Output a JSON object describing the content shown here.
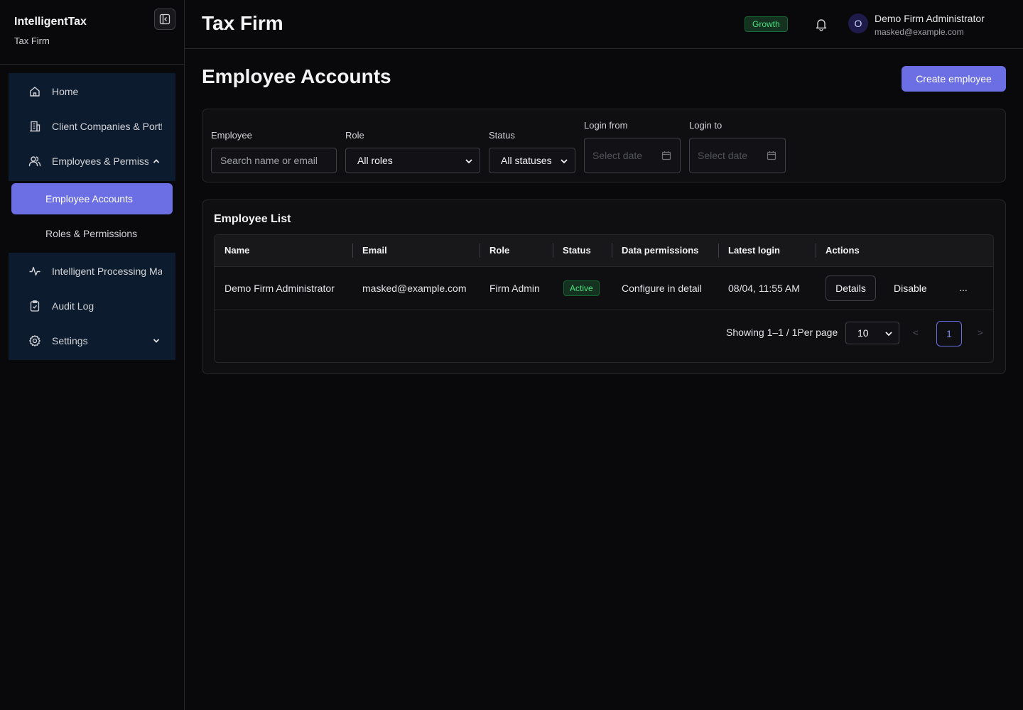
{
  "sidebar": {
    "brand": "IntelligentTax",
    "subtitle": "Tax Firm",
    "items": [
      {
        "label": "Home"
      },
      {
        "label": "Client Companies & Portfolios"
      },
      {
        "label": "Employees & Permissions"
      },
      {
        "label": "Intelligent Processing Management"
      },
      {
        "label": "Audit Log"
      },
      {
        "label": "Settings"
      }
    ],
    "sub_items": [
      {
        "label": "Employee Accounts",
        "active": true
      },
      {
        "label": "Roles & Permissions",
        "active": false
      }
    ]
  },
  "header": {
    "title": "Tax Firm",
    "plan": "Growth",
    "avatar_initial": "O",
    "user_name": "Demo Firm Administrator",
    "user_email": "masked@example.com"
  },
  "page": {
    "title": "Employee Accounts",
    "create_button": "Create employee"
  },
  "filters": {
    "employee_label": "Employee",
    "employee_placeholder": "Search name or email",
    "role_label": "Role",
    "role_value": "All roles",
    "status_label": "Status",
    "status_value": "All statuses",
    "login_from_label": "Login from",
    "login_from_placeholder": "Select date",
    "login_to_label": "Login to",
    "login_to_placeholder": "Select date"
  },
  "list": {
    "title": "Employee List",
    "columns": [
      "Name",
      "Email",
      "Role",
      "Status",
      "Data permissions",
      "Latest login",
      "Actions"
    ],
    "rows": [
      {
        "name": "Demo Firm Administrator",
        "email": "masked@example.com",
        "role": "Firm Admin",
        "status": "Active",
        "data_permissions": "Configure in detail",
        "latest_login": "08/04, 11:55 AM",
        "action_details": "Details",
        "action_disable": "Disable",
        "action_more": "..."
      }
    ],
    "pagination": {
      "summary": "Showing 1–1 / 1Per page",
      "page_size": "10",
      "prev": "<",
      "current_page": "1",
      "next": ">"
    }
  },
  "colors": {
    "accent": "#6c6fe4",
    "background": "#09090b",
    "nav_background": "#0c1b2e",
    "success": "#4ade80"
  },
  "icons": {
    "collapse": "sidebar-collapse-icon",
    "home": "home-icon",
    "building": "building-icon",
    "users": "users-icon",
    "activity": "activity-icon",
    "clipboard": "clipboard-icon",
    "gear": "gear-icon",
    "bell": "bell-icon",
    "calendar": "calendar-icon"
  }
}
